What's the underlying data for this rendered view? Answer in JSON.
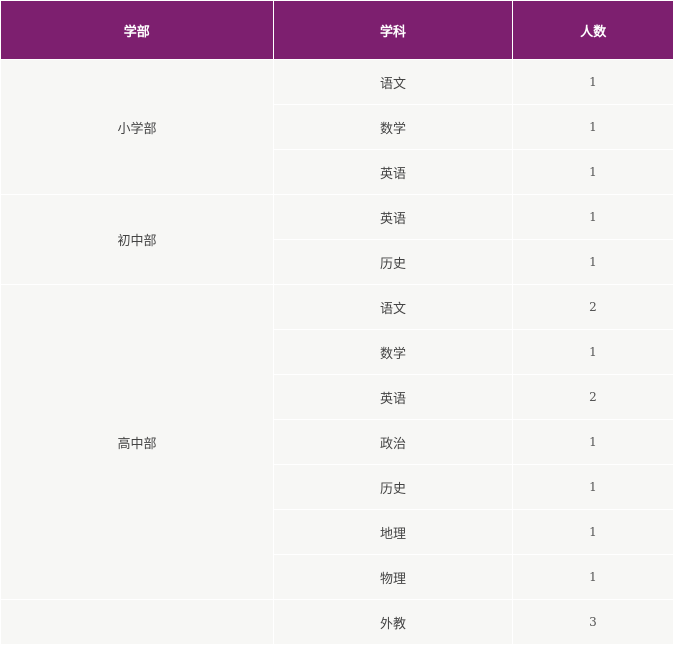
{
  "headers": {
    "department": "学部",
    "subject": "学科",
    "count": "人数"
  },
  "departments": [
    {
      "name": "小学部",
      "rows": [
        {
          "subject": "语文",
          "count": "1"
        },
        {
          "subject": "数学",
          "count": "1"
        },
        {
          "subject": "英语",
          "count": "1"
        }
      ]
    },
    {
      "name": "初中部",
      "rows": [
        {
          "subject": "英语",
          "count": "1"
        },
        {
          "subject": "历史",
          "count": "1"
        }
      ]
    },
    {
      "name": "高中部",
      "rows": [
        {
          "subject": "语文",
          "count": "2"
        },
        {
          "subject": "数学",
          "count": "1"
        },
        {
          "subject": "英语",
          "count": "2"
        },
        {
          "subject": "政治",
          "count": "1"
        },
        {
          "subject": "历史",
          "count": "1"
        },
        {
          "subject": "地理",
          "count": "1"
        },
        {
          "subject": "物理",
          "count": "1"
        }
      ]
    },
    {
      "name": "",
      "rows": [
        {
          "subject": "外教",
          "count": "3"
        }
      ]
    }
  ],
  "colors": {
    "header_bg": "#7d1f6f",
    "header_text": "#ffffff",
    "cell_bg": "#f7f7f5"
  }
}
